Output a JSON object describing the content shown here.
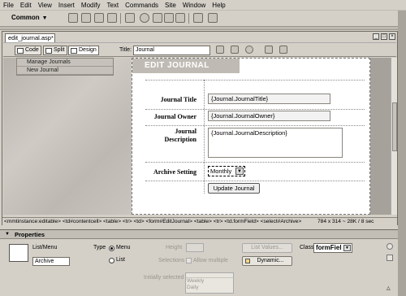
{
  "menu": [
    "File",
    "Edit",
    "View",
    "Insert",
    "Modify",
    "Text",
    "Commands",
    "Site",
    "Window",
    "Help"
  ],
  "insert_bar": {
    "category": "Common"
  },
  "document": {
    "tab_title": "edit_journal.asp*",
    "views": {
      "code": "Code",
      "split": "Split",
      "design": "Design"
    },
    "title_label": "Title:",
    "title_value": "Journal"
  },
  "nav_links": [
    "Manage Journals",
    "New Journal"
  ],
  "page": {
    "header": "EDIT JOURNAL",
    "labels": {
      "title": "Journal Title",
      "owner": "Journal Owner",
      "description_1": "Journal",
      "description_2": "Description",
      "archive": "Archive Setting"
    },
    "fields": {
      "title": "{Journal.JournalTitle}",
      "owner": "{Journal.JournalOwner}",
      "description": "{Journal.JournalDescription}",
      "archive_selected": "Monthly"
    },
    "submit": "Update Journal"
  },
  "status_bar": {
    "tag_selector": "<mmtinstance:editable> <td#contentcell> <table> <tr> <td> <form#EditJournal> <table> <tr> <td.formField> <select#Archive>",
    "window_size": "784 x 314 ~ 28K / 8 sec"
  },
  "properties": {
    "panel_title": "Properties",
    "element_type": "List/Menu",
    "element_name": "Archive",
    "type_label": "Type",
    "type_menu": "Menu",
    "type_list": "List",
    "height_label": "Height",
    "selections_label": "Selections",
    "allow_multiple": "Allow multiple",
    "list_values": "List Values...",
    "dynamic": "Dynamic...",
    "class_label": "Class",
    "class_value": "formFiel",
    "initially_selected": "Initially selected",
    "options": [
      "Weekly",
      "Daily"
    ]
  }
}
